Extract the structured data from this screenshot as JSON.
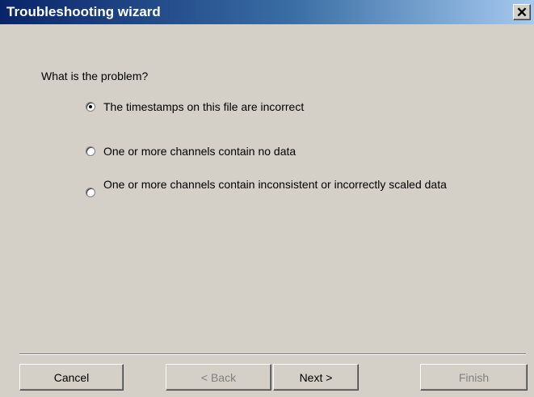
{
  "window": {
    "title": "Troubleshooting wizard",
    "close_glyph": "✕"
  },
  "question": "What is the problem?",
  "options": [
    {
      "label": "The timestamps on this file are incorrect",
      "selected": true
    },
    {
      "label": "One or more channels contain no data",
      "selected": false
    },
    {
      "label": "One or more channels contain inconsistent or incorrectly scaled data",
      "selected": false
    }
  ],
  "buttons": {
    "cancel": "Cancel",
    "back": "< Back",
    "next": "Next >",
    "finish": "Finish"
  }
}
